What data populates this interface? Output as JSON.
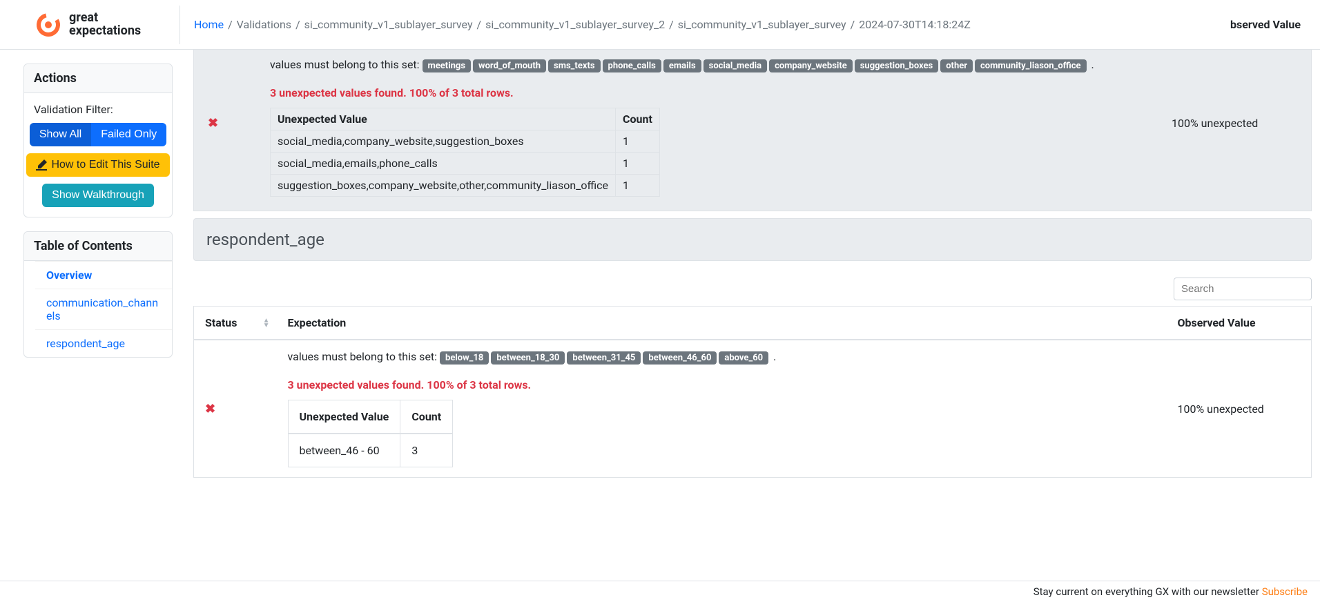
{
  "logo": {
    "line1": "great",
    "line2": "expectations"
  },
  "breadcrumbs": {
    "home": "Home",
    "items": [
      "Validations",
      "si_community_v1_sublayer_survey",
      "si_community_v1_sublayer_survey_2",
      "si_community_v1_sublayer_survey",
      "2024-07-30T14:18:24Z"
    ]
  },
  "partial_header": "bserved Value",
  "sidebar": {
    "actions_title": "Actions",
    "validation_filter_label": "Validation Filter:",
    "show_all": "Show All",
    "failed_only": "Failed Only",
    "how_to_edit": "How to Edit This Suite",
    "show_walkthrough": "Show Walkthrough",
    "toc_title": "Table of Contents",
    "toc": [
      {
        "label": "Overview",
        "active": true
      },
      {
        "label": "communication_channels",
        "active": false
      },
      {
        "label": "respondent_age",
        "active": false
      }
    ]
  },
  "section1": {
    "prefix": "values must belong to this set: ",
    "pills": [
      "meetings",
      "word_of_mouth",
      "sms_texts",
      "phone_calls",
      "emails",
      "social_media",
      "company_website",
      "suggestion_boxes",
      "other",
      "community_liason_office"
    ],
    "summary": "3 unexpected values found. 100% of 3 total rows.",
    "table": {
      "headers": [
        "Unexpected Value",
        "Count"
      ],
      "rows": [
        [
          "social_media,company_website,suggestion_boxes",
          "1"
        ],
        [
          "social_media,emails,phone_calls",
          "1"
        ],
        [
          "suggestion_boxes,company_website,other,community_liason_office",
          "1"
        ]
      ]
    },
    "observed": "100% unexpected"
  },
  "section2_title": "respondent_age",
  "search_placeholder": "Search",
  "table2": {
    "headers": {
      "status": "Status",
      "expectation": "Expectation",
      "observed": "Observed Value"
    }
  },
  "section2_row": {
    "prefix": "values must belong to this set: ",
    "pills": [
      "below_18",
      "between_18_30",
      "between_31_45",
      "between_46_60",
      "above_60"
    ],
    "summary": "3 unexpected values found. 100% of 3 total rows.",
    "table": {
      "headers": [
        "Unexpected Value",
        "Count"
      ],
      "rows": [
        [
          "between_46 - 60",
          "3"
        ]
      ]
    },
    "observed": "100% unexpected"
  },
  "footer": {
    "text": "Stay current on everything GX with our newsletter ",
    "cta": "Subscribe"
  }
}
